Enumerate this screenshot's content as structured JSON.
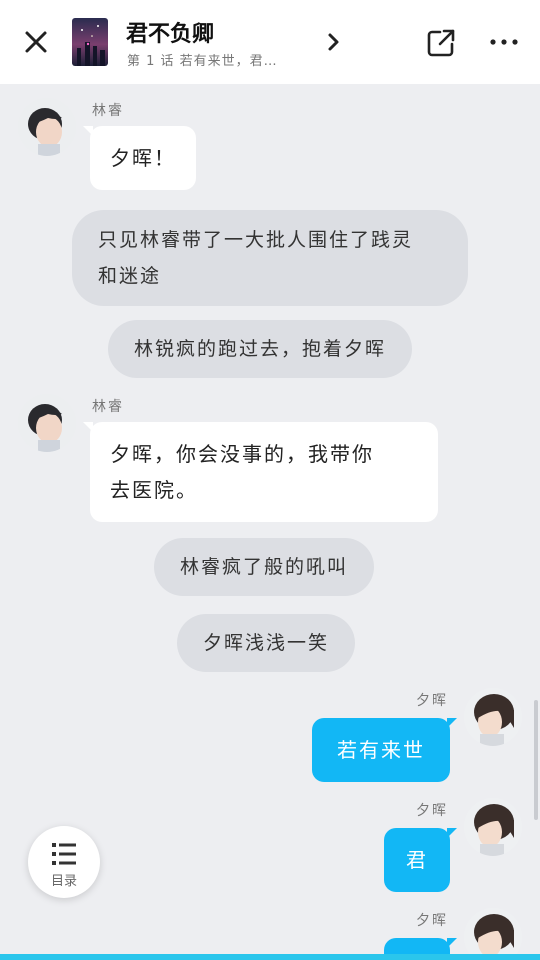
{
  "header": {
    "title": "君不负卿",
    "subtitle": "第 1 话 若有来世，君…"
  },
  "messages": {
    "m1": {
      "sender": "林睿",
      "text": "夕晖！"
    },
    "n1": {
      "text_line1": "只见林睿带了一大批人围住了践灵",
      "text_line2": "和迷途"
    },
    "n2": {
      "text": "林锐疯的跑过去，抱着夕晖"
    },
    "m2": {
      "sender": "林睿",
      "text_line1": "夕晖，你会没事的，我带你",
      "text_line2": "去医院。"
    },
    "n3": {
      "text": "林睿疯了般的吼叫"
    },
    "n4": {
      "text": "夕晖浅浅一笑"
    },
    "m3": {
      "sender": "夕晖",
      "text": "若有来世"
    },
    "m4": {
      "sender": "夕晖",
      "text": "君"
    },
    "m5": {
      "sender": "夕晖",
      "text": ""
    }
  },
  "toc": {
    "label": "目录"
  },
  "colors": {
    "accent": "#12b7f5",
    "background": "#edeef1",
    "narration": "#dcdee3",
    "bottom_bar": "#2bc6ec"
  }
}
